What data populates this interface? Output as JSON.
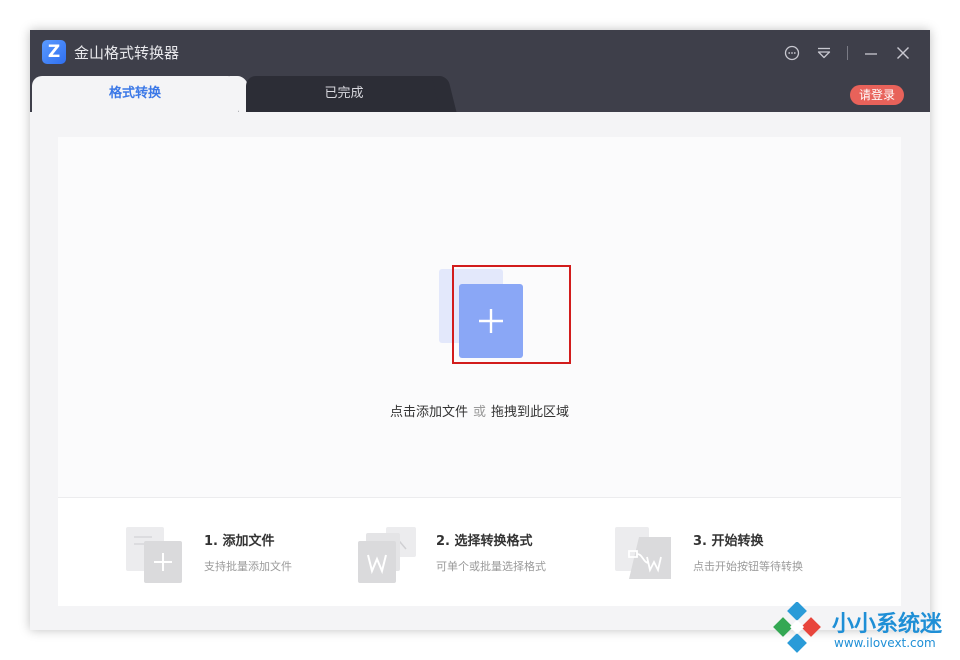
{
  "app": {
    "title": "金山格式转换器",
    "logo_letter": "Z"
  },
  "tabs": [
    {
      "label": "格式转换",
      "active": true
    },
    {
      "label": "已完成",
      "active": false
    }
  ],
  "login_label": "请登录",
  "drop_zone": {
    "hint_click": "点击添加文件",
    "hint_or": "或",
    "hint_drag": "拖拽到此区域"
  },
  "steps": [
    {
      "title": "1. 添加文件",
      "desc": "支持批量添加文件",
      "icon": "add-file-icon"
    },
    {
      "title": "2. 选择转换格式",
      "desc": "可单个或批量选择格式",
      "icon": "select-format-icon"
    },
    {
      "title": "3. 开始转换",
      "desc": "点击开始按钮等待转换",
      "icon": "start-convert-icon"
    }
  ],
  "window_controls": [
    "chat-icon",
    "menu-icon",
    "minimize-icon",
    "close-icon"
  ],
  "watermark": {
    "name": "小小系统迷",
    "url": "www.ilovext.com"
  },
  "colors": {
    "titlebar": "#3e3f4a",
    "accent": "#3b78e7",
    "login_badge": "#e8625a",
    "add_button": "#8aa7f6",
    "highlight": "#d21c1c"
  }
}
